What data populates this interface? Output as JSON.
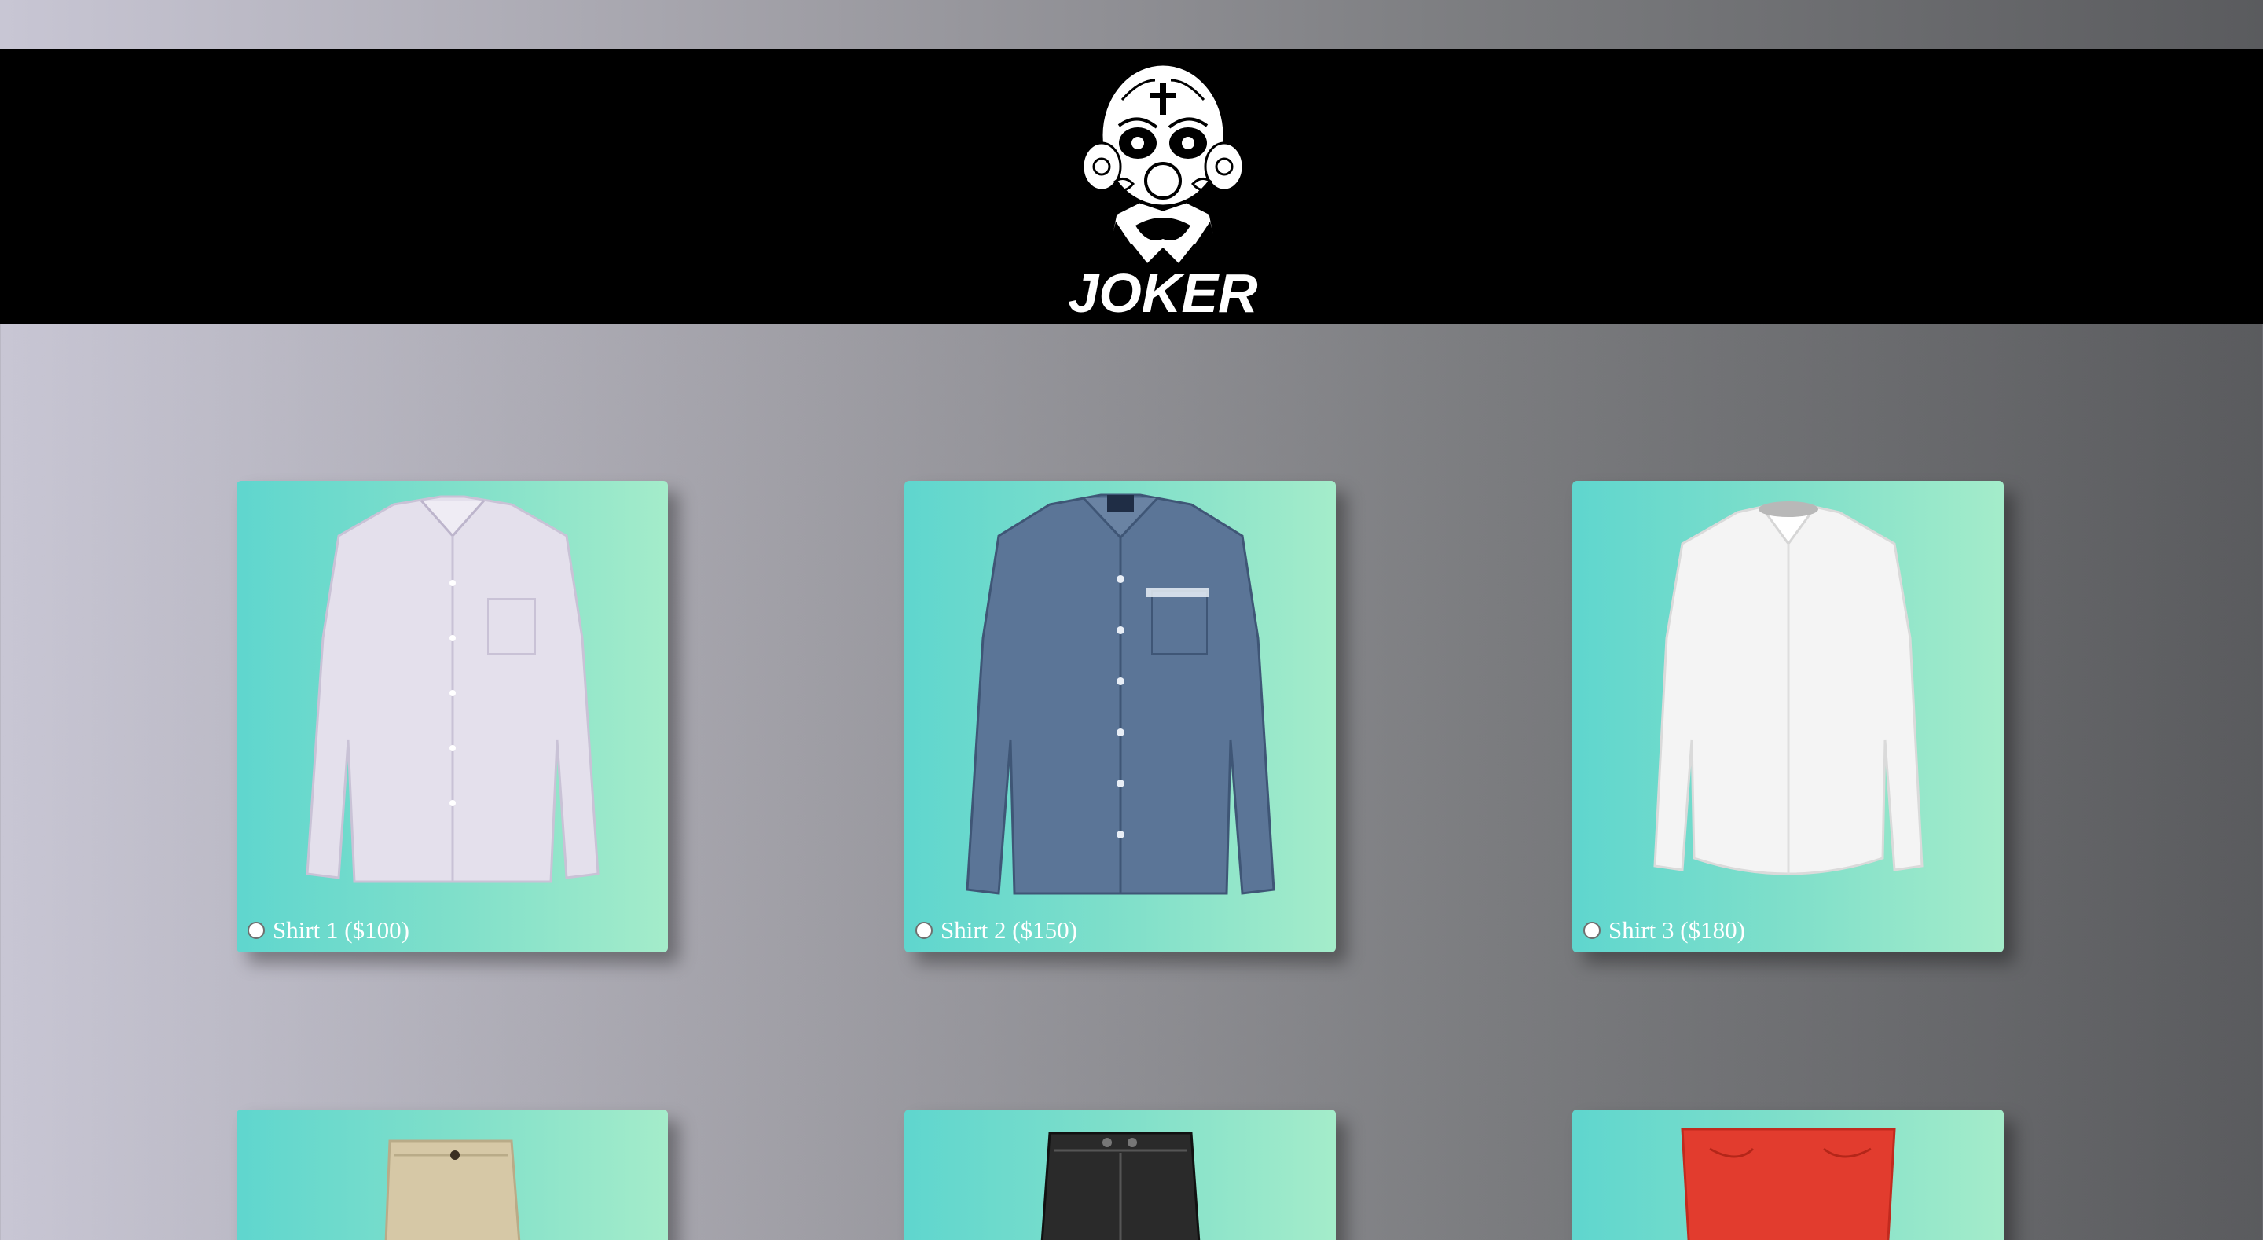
{
  "brand": {
    "name": "JOKER",
    "logo_icon": "joker-clown-skull-icon"
  },
  "colors": {
    "header_bg": "#000000",
    "card_gradient_start": "#5fd6ce",
    "card_gradient_end": "#a4ecca",
    "label_text": "#ffffff"
  },
  "products": [
    {
      "label": "Shirt 1 ($100)",
      "icon": "lavender-dress-shirt-icon",
      "selected": false
    },
    {
      "label": "Shirt 2 ($150)",
      "icon": "blue-chambray-shirt-icon",
      "selected": false
    },
    {
      "label": "Shirt 3 ($180)",
      "icon": "white-dress-shirt-icon",
      "selected": false
    }
  ],
  "products_row2": [
    {
      "icon": "beige-shorts-icon"
    },
    {
      "icon": "black-shorts-icon"
    },
    {
      "icon": "red-pants-icon"
    }
  ]
}
